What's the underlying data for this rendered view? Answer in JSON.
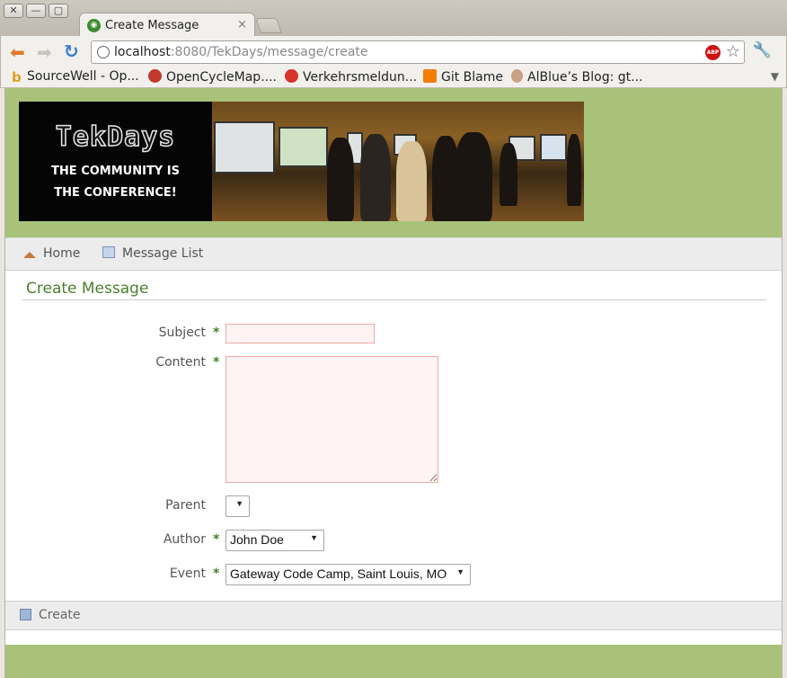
{
  "window": {
    "controls": [
      "✕",
      "—",
      "▢"
    ]
  },
  "tab": {
    "title": "Create Message",
    "favicon": "grails-icon",
    "close": "×"
  },
  "toolbar": {
    "url_host": "localhost",
    "url_rest": ":8080/TekDays/message/create",
    "abp_label": "ABP"
  },
  "bookmarks": [
    {
      "label": "SourceWell - Op...",
      "icon": "b-icon",
      "color": "#e0a020"
    },
    {
      "label": "OpenCycleMap....",
      "icon": "cyclist-icon",
      "color": "#c0392b"
    },
    {
      "label": "Verkehrsmeldun...",
      "icon": "traffic-icon",
      "color": "#d6332a"
    },
    {
      "label": "Git Blame",
      "icon": "blogger-icon",
      "color": "#f57d00"
    },
    {
      "label": "AlBlue’s Blog: gt...",
      "icon": "avatar-icon",
      "color": "#b08060"
    }
  ],
  "logo": {
    "title": "TekDays",
    "tagline_1": "THE COMMUNITY IS",
    "tagline_2": "THE CONFERENCE!"
  },
  "nav": {
    "home": "Home",
    "message_list": "Message List"
  },
  "page_title": "Create Message",
  "form": {
    "subject_label": "Subject",
    "content_label": "Content",
    "parent_label": "Parent",
    "author_label": "Author",
    "event_label": "Event",
    "required_mark": "*",
    "parent_value": "",
    "author_value": "John Doe",
    "event_value": "Gateway Code Camp, Saint Louis, MO",
    "subject_value": "",
    "content_value": ""
  },
  "buttons": {
    "create": "Create"
  },
  "colors": {
    "brand_green": "#a8c27a",
    "title_green": "#48802c",
    "error_fill": "#fff3f3",
    "error_border": "#f0a8a8"
  }
}
